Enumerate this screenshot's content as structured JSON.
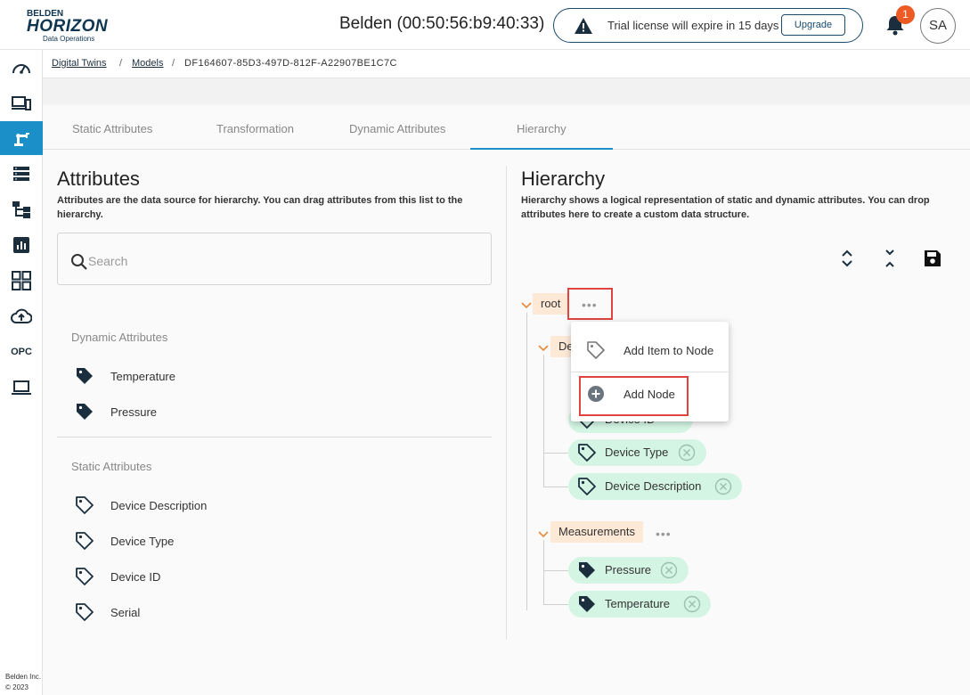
{
  "header": {
    "logo_top": "BELDEN",
    "logo_main": "HORIZON",
    "logo_sub": "Data Operations",
    "device_title": "Belden (00:50:56:b9:40:33)",
    "trial_message": "Trial license will expire in 15 days",
    "upgrade_label": "Upgrade",
    "notification_count": "1",
    "avatar_initials": "SA"
  },
  "sidebar": {
    "items": [
      {
        "icon": "dashboard-icon"
      },
      {
        "icon": "devices-icon"
      },
      {
        "icon": "robot-arm-icon",
        "active": true
      },
      {
        "icon": "list-icon"
      },
      {
        "icon": "hierarchy-icon"
      },
      {
        "icon": "report-icon"
      },
      {
        "icon": "apps-grid-icon"
      },
      {
        "icon": "cloud-upload-icon"
      },
      {
        "label": "OPC"
      },
      {
        "icon": "laptop-icon"
      }
    ],
    "footer_line1": "Belden Inc.",
    "footer_line2": "© 2023"
  },
  "breadcrumb": {
    "items": [
      "Digital Twins",
      "Models"
    ],
    "separator": "/",
    "current": "DF164607-85D3-497D-812F-A22907BE1C7C"
  },
  "tabs": [
    {
      "label": "Static Attributes"
    },
    {
      "label": "Transformation"
    },
    {
      "label": "Dynamic Attributes"
    },
    {
      "label": "Hierarchy",
      "active": true
    }
  ],
  "attributes": {
    "title": "Attributes",
    "description_line1": "Attributes are the data source for hierarchy. You can drag attributes from this list to the",
    "description_line2": "hierarchy.",
    "search_placeholder": "Search",
    "dynamic_label": "Dynamic Attributes",
    "dynamic_items": [
      "Temperature",
      "Pressure"
    ],
    "static_label": "Static Attributes",
    "static_items": [
      "Device Description",
      "Device Type",
      "Device ID",
      "Serial"
    ]
  },
  "hierarchy": {
    "title": "Hierarchy",
    "description_line1": "Hierarchy shows a logical representation of static and dynamic attributes. You can drop",
    "description_line2": "attributes here to create a custom data structure.",
    "root_label": "root",
    "node1_label": "De",
    "node1_chip_partial": "Device ID",
    "node1_chips": [
      "Device Type",
      "Device Description"
    ],
    "node2_label": "Measurements",
    "node2_chips": [
      "Pressure",
      "Temperature"
    ],
    "dots": "•••"
  },
  "context_menu": {
    "items": [
      {
        "label": "Add Item to Node",
        "icon": "tag-outline-icon"
      },
      {
        "label": "Add Node",
        "icon": "plus-circle-icon"
      }
    ]
  },
  "colors": {
    "accent": "#1b90c8",
    "navy": "#0f3551",
    "node_bg": "#fde9d6",
    "chip_bg": "#d4f5e4",
    "highlight": "#e0443e",
    "badge": "#ee5a24"
  }
}
